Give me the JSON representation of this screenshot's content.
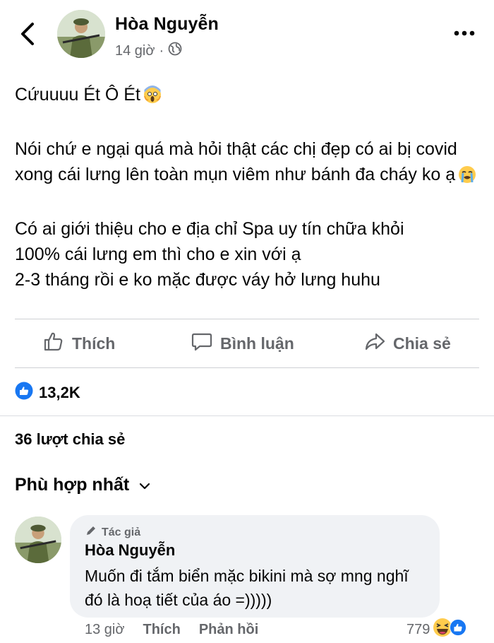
{
  "header": {
    "author": "Hòa Nguyễn",
    "time": "14 giờ",
    "separator": "·",
    "icons": [
      "back-arrow-icon",
      "globe-icon",
      "more-icon"
    ]
  },
  "post": {
    "line1": "Cứuuuu Ét Ô Ét",
    "para2": "Nói chứ e ngại quá mà hỏi thật các chị đẹp có ai bị covid xong cái lưng lên toàn mụn viêm như bánh đa cháy ko ạ",
    "para3_l1": "Có ai giới thiệu cho e địa chỉ Spa uy tín chữa khỏi",
    "para3_l2": "100% cái lưng em thì cho e xin với ạ",
    "para3_l3": "2-3 tháng rồi e ko mặc được váy hở lưng huhu"
  },
  "actions": {
    "like": "Thích",
    "comment": "Bình luận",
    "share": "Chia sẻ"
  },
  "stats": {
    "reactions": "13,2K",
    "shares": "36 lượt chia sẻ"
  },
  "comments": {
    "sort_label": "Phù hợp nhất",
    "items": [
      {
        "badge": "Tác giả",
        "author": "Hòa Nguyễn",
        "text": "Muốn đi tắm biển mặc bikini mà sợ mng nghĩ đó là hoạ tiết của áo =)))))",
        "time": "13 giờ",
        "like": "Thích",
        "reply": "Phản hồi",
        "reaction_count": "779"
      }
    ]
  },
  "colors": {
    "text": "#050505",
    "secondary": "#65676b",
    "like_blue": "#1877f2",
    "bubble": "#f0f2f5"
  }
}
